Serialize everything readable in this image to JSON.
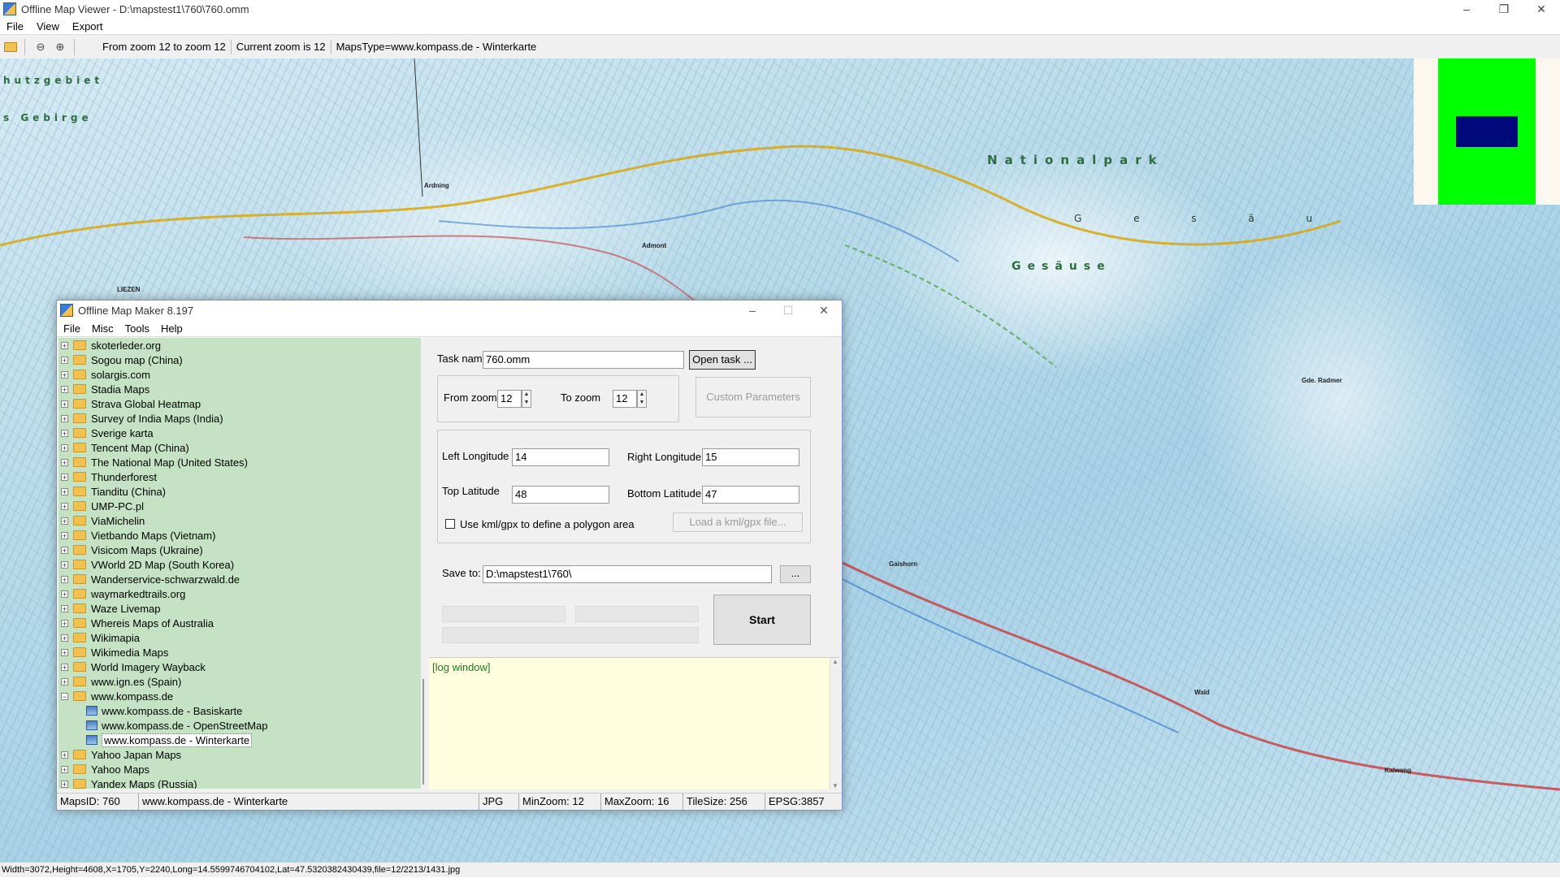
{
  "viewer": {
    "title": "Offline Map Viewer - D:\\mapstest1\\760\\760.omm",
    "menu": [
      "File",
      "View",
      "Export"
    ],
    "toolbar": {
      "zoom_range": "From zoom 12 to zoom 12",
      "current_zoom": "Current zoom is 12",
      "maps_type": "MapsType=www.kompass.de - Winterkarte"
    },
    "status": "Width=3072,Height=4608,X=1705,Y=2240,Long=14.5599746704102,Lat=47.5320382430439,file=12/2213/1431.jpg",
    "map_labels": {
      "nationalpark": "Nationalpark",
      "gesause": "Gesäuse",
      "g_e_s_a_u": "G e s ä u",
      "schutzgebiet": "hutzgebiet",
      "gebirge": "s Gebirge",
      "liezen": "LIEZEN",
      "admont": "Admont",
      "ardning": "Ardning",
      "gde_radmer": "Gde. Radmer",
      "gaishorn": "Gaishorn",
      "wald": "Wald",
      "kalwang": "Kalwang"
    },
    "colors": {
      "minimap_green": "#00ff00",
      "minimap_blue": "#00097a",
      "tree_bg": "#c5e3c4",
      "log_bg": "#ffffe0"
    }
  },
  "maker": {
    "title": "Offline Map Maker 8.197",
    "menu": [
      "File",
      "Misc",
      "Tools",
      "Help"
    ],
    "tree": [
      {
        "label": "skoterleder.org",
        "type": "folder"
      },
      {
        "label": "Sogou map (China)",
        "type": "folder"
      },
      {
        "label": "solargis.com",
        "type": "folder"
      },
      {
        "label": "Stadia Maps",
        "type": "folder"
      },
      {
        "label": "Strava Global Heatmap",
        "type": "folder"
      },
      {
        "label": "Survey of India Maps (India)",
        "type": "folder"
      },
      {
        "label": "Sverige karta",
        "type": "folder"
      },
      {
        "label": "Tencent Map (China)",
        "type": "folder"
      },
      {
        "label": "The National Map (United States)",
        "type": "folder"
      },
      {
        "label": "Thunderforest",
        "type": "folder"
      },
      {
        "label": "Tianditu (China)",
        "type": "folder"
      },
      {
        "label": "UMP-PC.pl",
        "type": "folder"
      },
      {
        "label": "ViaMichelin",
        "type": "folder"
      },
      {
        "label": "Vietbando Maps (Vietnam)",
        "type": "folder"
      },
      {
        "label": "Visicom Maps (Ukraine)",
        "type": "folder"
      },
      {
        "label": "VWorld 2D Map (South Korea)",
        "type": "folder"
      },
      {
        "label": "Wanderservice-schwarzwald.de",
        "type": "folder"
      },
      {
        "label": "waymarkedtrails.org",
        "type": "folder"
      },
      {
        "label": "Waze Livemap",
        "type": "folder"
      },
      {
        "label": "Whereis Maps of Australia",
        "type": "folder"
      },
      {
        "label": "Wikimapia",
        "type": "folder"
      },
      {
        "label": "Wikimedia Maps",
        "type": "folder"
      },
      {
        "label": "World Imagery Wayback",
        "type": "folder"
      },
      {
        "label": "www.ign.es (Spain)",
        "type": "folder"
      },
      {
        "label": "www.kompass.de",
        "type": "open-folder"
      },
      {
        "label": "www.kompass.de - Basiskarte",
        "type": "map"
      },
      {
        "label": "www.kompass.de - OpenStreetMap",
        "type": "map"
      },
      {
        "label": "www.kompass.de - Winterkarte",
        "type": "map",
        "selected": true
      },
      {
        "label": "Yahoo Japan Maps",
        "type": "folder"
      },
      {
        "label": "Yahoo Maps",
        "type": "folder"
      },
      {
        "label": "Yandex Maps (Russia)",
        "type": "folder"
      }
    ],
    "task_name_label": "Task name",
    "task_name_value": "760.omm",
    "open_task": "Open task ...",
    "from_zoom_label": "From zoom",
    "from_zoom_value": "12",
    "to_zoom_label": "To zoom",
    "to_zoom_value": "12",
    "custom_params": "Custom Parameters",
    "left_lon_label": "Left Longitude",
    "left_lon_value": "14",
    "right_lon_label": "Right Longitude",
    "right_lon_value": "15",
    "top_lat_label": "Top Latitude",
    "top_lat_value": "48",
    "bottom_lat_label": "Bottom Latitude",
    "bottom_lat_value": "47",
    "kml_checkbox_label": "Use kml/gpx to define a polygon area",
    "load_kml": "Load a kml/gpx file...",
    "save_to_label": "Save to:",
    "save_to_value": "D:\\mapstest1\\760\\",
    "browse": "...",
    "start": "Start",
    "log": "[log window]",
    "status": {
      "maps_id": "MapsID: 760",
      "maps_name": "www.kompass.de - Winterkarte",
      "format": "JPG",
      "min_zoom": "MinZoom: 12",
      "max_zoom": "MaxZoom: 16",
      "tile_size": "TileSize: 256",
      "epsg": "EPSG:3857"
    }
  }
}
